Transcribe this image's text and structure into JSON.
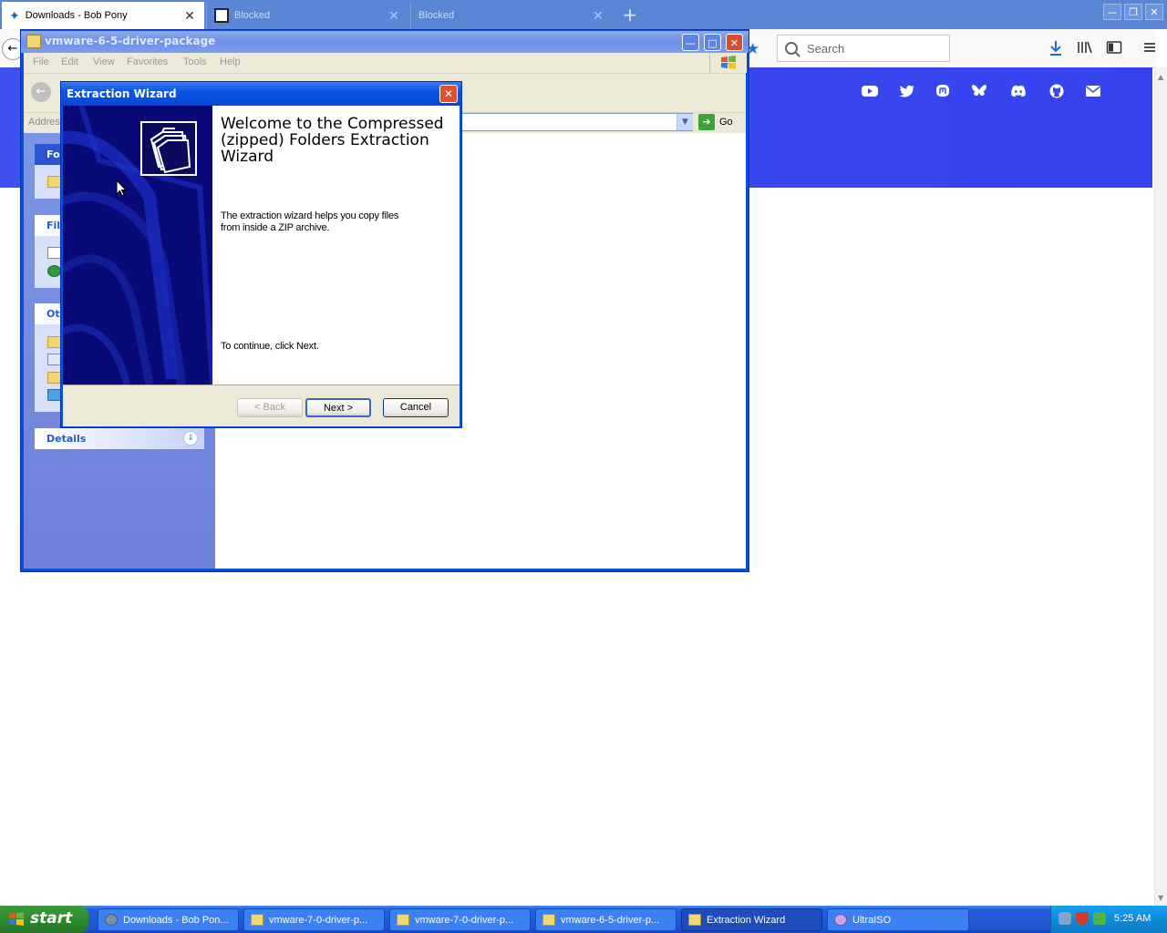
{
  "browser": {
    "tabs": [
      {
        "label": "Downloads - Bob Pony",
        "active": true
      },
      {
        "label": "Blocked",
        "active": false
      },
      {
        "label": "Blocked",
        "active": false
      }
    ],
    "search_placeholder": "Search",
    "social_icons": [
      "youtube-icon",
      "twitter-icon",
      "mastodon-icon",
      "bluesky-icon",
      "discord-icon",
      "github-icon",
      "email-icon"
    ],
    "banner_color": "#3a48ef"
  },
  "explorer": {
    "title": "vmware-6-5-driver-package",
    "menu": [
      "File",
      "Edit",
      "View",
      "Favorites",
      "Tools",
      "Help"
    ],
    "address_label": "Address",
    "go_label": "Go",
    "left_panel": {
      "folder_tasks_head": "Fol",
      "file_tasks_head": "File",
      "other_places_head": "Ot",
      "details_head": "Details"
    }
  },
  "wizard": {
    "title": "Extraction Wizard",
    "heading": "Welcome to the Compressed (zipped) Folders Extraction Wizard",
    "description": "The extraction wizard helps you copy files from inside a ZIP archive.",
    "continue_text": "To continue, click Next.",
    "buttons": {
      "back": "< Back",
      "next": "Next >",
      "cancel": "Cancel"
    }
  },
  "taskbar": {
    "start_label": "start",
    "items": [
      {
        "label": "Downloads - Bob Pon...",
        "active": false
      },
      {
        "label": "vmware-7-0-driver-p...",
        "active": false
      },
      {
        "label": "vmware-7-0-driver-p...",
        "active": false
      },
      {
        "label": "vmware-6-5-driver-p...",
        "active": false
      },
      {
        "label": "Extraction Wizard",
        "active": true
      },
      {
        "label": "UltraISO",
        "active": false
      }
    ],
    "clock": "5:25 AM"
  }
}
